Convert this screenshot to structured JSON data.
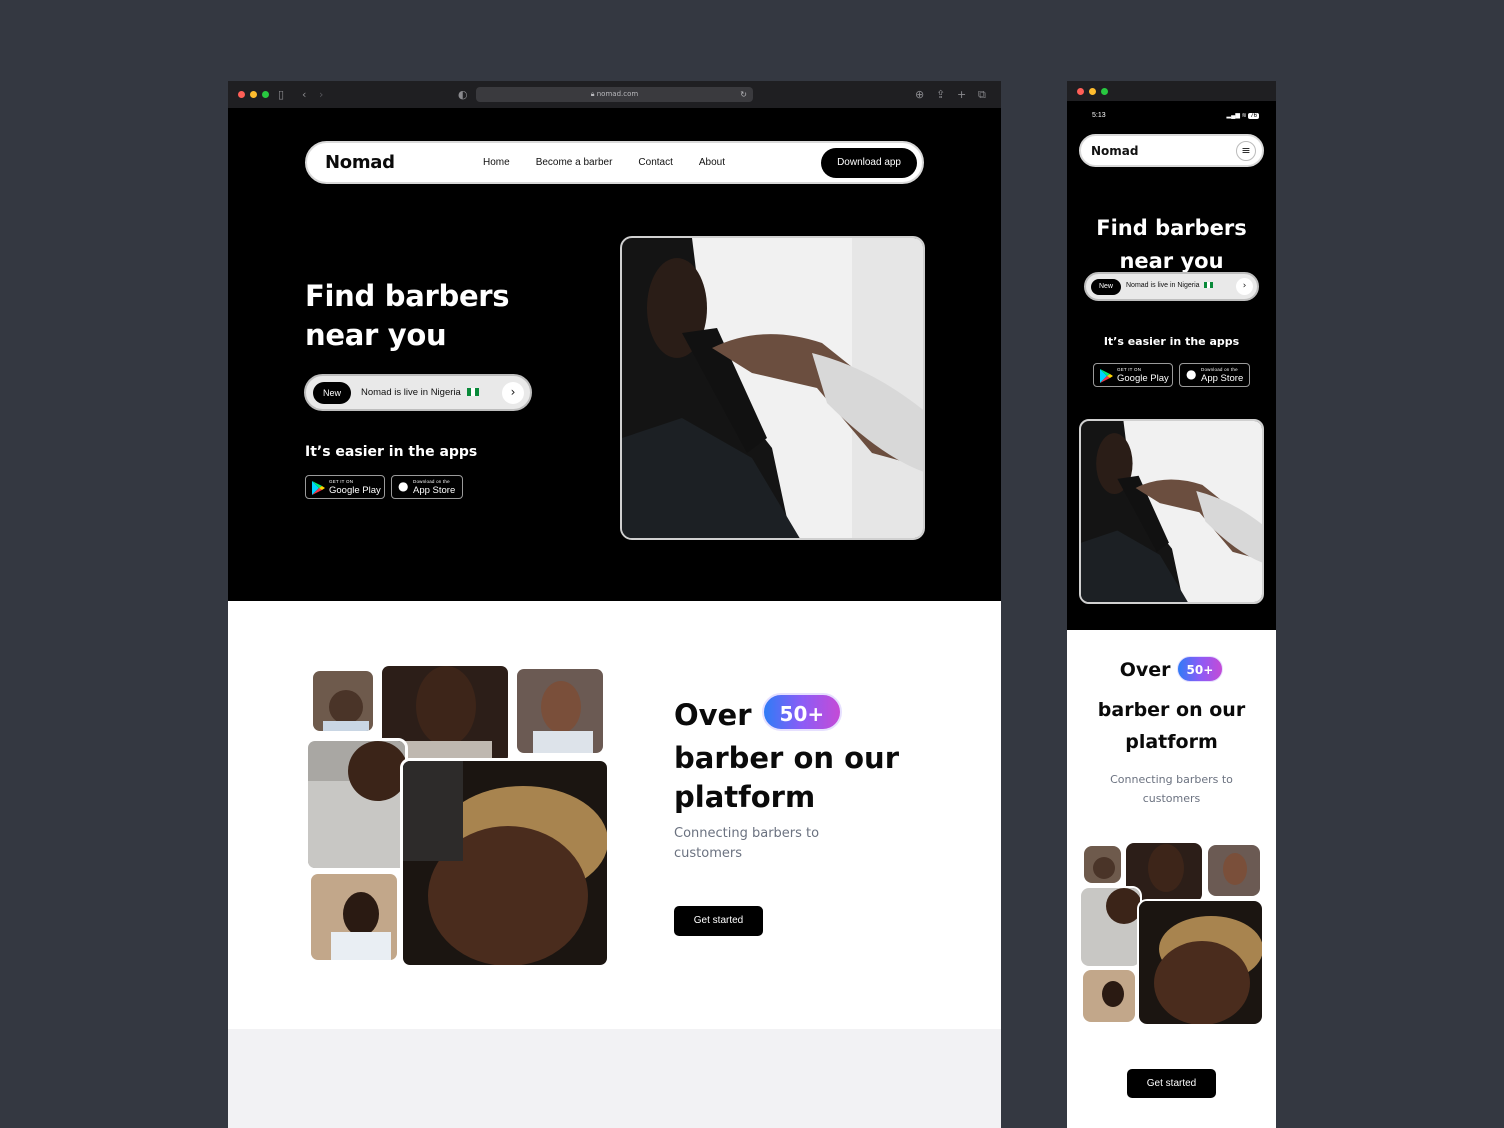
{
  "desktop": {
    "url": "nomad.com",
    "nav": {
      "logo": "Nomad",
      "links": [
        "Home",
        "Become a barber",
        "Contact",
        "About"
      ],
      "cta": "Download app"
    },
    "hero": {
      "title": "Find barbers near you",
      "pill_badge": "New",
      "pill_text": "Nomad is live in Nigeria",
      "apps_heading": "It’s easier in the apps",
      "google_small": "GET IT ON",
      "google_big": "Google Play",
      "apple_small": "Download on the",
      "apple_big": "App Store"
    },
    "platform": {
      "over": "Over",
      "count": "50+",
      "headline": "barber on our platform",
      "subtext": "Connecting barbers to customers",
      "cta": "Get started"
    }
  },
  "mobile": {
    "time": "5:13",
    "battery": "76",
    "logo": "Nomad",
    "title": "Find barbers near you",
    "pill_badge": "New",
    "pill_text": "Nomad is live in Nigeria",
    "apps_heading": "It’s easier in the apps",
    "google_small": "GET IT ON",
    "google_big": "Google Play",
    "apple_small": "Download on the",
    "apple_big": "App Store",
    "over": "Over",
    "count": "50+",
    "headline": "barber on our platform",
    "subtext": "Connecting barbers to customers",
    "cta": "Get started"
  },
  "colors": {
    "page_bg": "#343841",
    "hero_bg": "#000000",
    "badge_gradient": [
      "#2f7cf6",
      "#8b5cf6",
      "#c54bd6"
    ],
    "subtext": "#6b7280"
  }
}
